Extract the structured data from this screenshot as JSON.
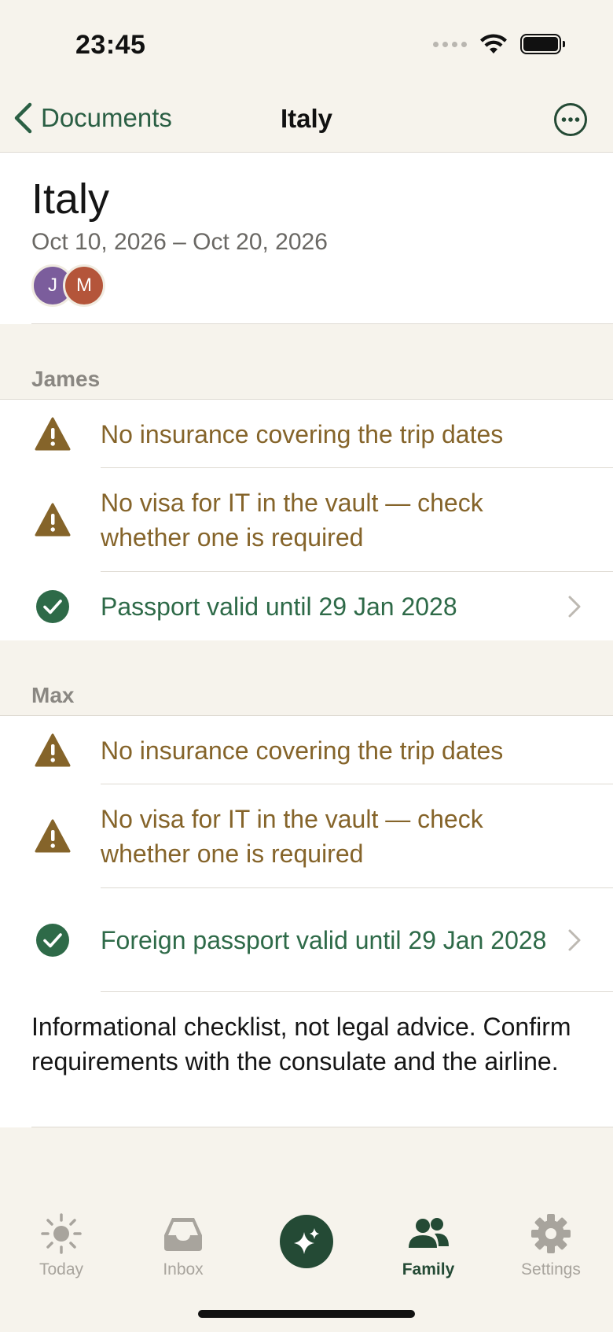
{
  "status": {
    "time": "23:45"
  },
  "nav": {
    "back_label": "Documents",
    "title": "Italy"
  },
  "trip": {
    "title": "Italy",
    "dates": "Oct 10, 2026 – Oct 20, 2026",
    "avatars": [
      {
        "initial": "J",
        "color": "#7b5d9c"
      },
      {
        "initial": "M",
        "color": "#b4553a"
      }
    ]
  },
  "sections": [
    {
      "name": "James",
      "items": [
        {
          "status": "warning",
          "text": "No insurance covering the trip dates"
        },
        {
          "status": "warning",
          "text": "No visa for IT in the vault — check whether one is required"
        },
        {
          "status": "ok",
          "text": "Passport valid until 29 Jan 2028",
          "has_chevron": true
        }
      ]
    },
    {
      "name": "Max",
      "items": [
        {
          "status": "warning",
          "text": "No insurance covering the trip dates"
        },
        {
          "status": "warning",
          "text": "No visa for IT in the vault — check whether one is required"
        },
        {
          "status": "ok",
          "text": "Foreign passport valid until 29 Jan 2028",
          "has_chevron": true
        }
      ]
    }
  ],
  "disclaimer": "Informational checklist, not legal advice. Confirm requirements with the consulate and the airline.",
  "tabs": [
    {
      "label": "Today",
      "icon": "sun-icon",
      "active": false
    },
    {
      "label": "Inbox",
      "icon": "inbox-tray-icon",
      "active": false
    },
    {
      "label": "",
      "icon": "sparkles-icon",
      "active": false
    },
    {
      "label": "Family",
      "icon": "people-icon",
      "active": true
    },
    {
      "label": "Settings",
      "icon": "gear-icon",
      "active": false
    }
  ],
  "colors": {
    "accent": "#244a35",
    "warning": "#85642a",
    "success": "#2e6a48",
    "background": "#f6f3ec"
  }
}
